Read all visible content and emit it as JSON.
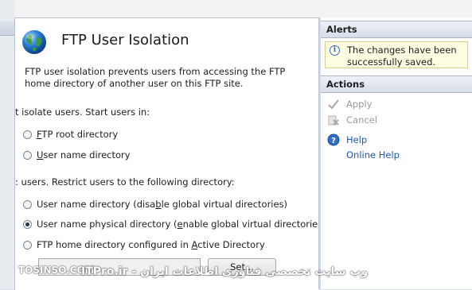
{
  "feature": {
    "title": "FTP User Isolation",
    "description": "FTP user isolation prevents users from accessing the FTP home directory of another user on this FTP site."
  },
  "no_isolation": {
    "heading": "t isolate users. Start users in:",
    "options": [
      {
        "pre": "",
        "u": "F",
        "post": "TP root directory",
        "selected": false
      },
      {
        "pre": "",
        "u": "U",
        "post": "ser name directory",
        "selected": false
      }
    ]
  },
  "isolation": {
    "heading": ": users. Restrict users to the following directory:",
    "options": [
      {
        "pre": "User name directory (disa",
        "u": "b",
        "post": "le global virtual directories)",
        "selected": false
      },
      {
        "pre": "User name physical directory (",
        "u": "e",
        "post": "nable global virtual directories)",
        "selected": true
      },
      {
        "pre": "FTP home directory configured in ",
        "u": "A",
        "post": "ctive Directory",
        "selected": false
      }
    ]
  },
  "set_button": "Set...",
  "alerts": {
    "header": "Alerts",
    "message": "The changes have been successfully saved.",
    "icon": "info-icon"
  },
  "actions": {
    "header": "Actions",
    "apply": "Apply",
    "cancel": "Cancel",
    "help": "Help",
    "online_help": "Online Help"
  },
  "watermark": {
    "left": "TOSINSO.COM",
    "right": "وب سایت تخصصی فناوری اطلاعات ایران - ITPro.ir"
  },
  "colors": {
    "link": "#1f5bb5",
    "pane_header": "#d6dee8",
    "alert_bg": "#fffde1"
  }
}
